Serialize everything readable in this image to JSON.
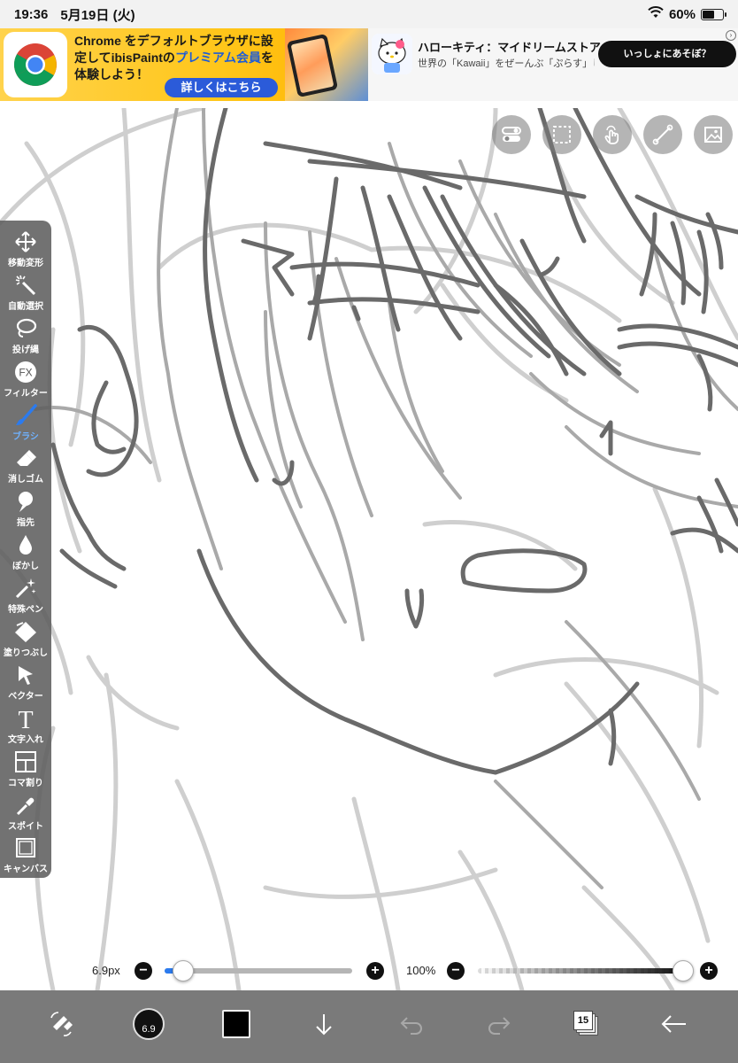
{
  "status_bar": {
    "time": "19:36",
    "date": "5月19日 (火)",
    "battery": "60%",
    "battery_level": 0.6
  },
  "ads": {
    "chrome": {
      "line1_prefix": "Chrome をデフォルトブラウザに設",
      "line2_prefix": "定してibisPaintの",
      "line2_highlight": "プレミアム会員",
      "line2_suffix": "を",
      "line3": "体験しよう！",
      "cta": "詳しくはこちら"
    },
    "kitty": {
      "title": "ハローキティ：マイドリームストア",
      "subtitle": "世界の「Kawaii」をぜーんぶ「ぷらす」し…",
      "cta": "いっしょにあそぼ？"
    }
  },
  "top_tools": [
    {
      "name": "toggle-icon"
    },
    {
      "name": "selection-icon"
    },
    {
      "name": "touch-icon"
    },
    {
      "name": "ruler-icon"
    },
    {
      "name": "reference-image-icon"
    }
  ],
  "toolbar": {
    "tools": [
      {
        "id": "move",
        "label": "移動変形",
        "icon": "move-icon",
        "active": false
      },
      {
        "id": "magic",
        "label": "自動選択",
        "icon": "magic-wand-icon",
        "active": false
      },
      {
        "id": "lasso",
        "label": "投げ縄",
        "icon": "lasso-icon",
        "active": false
      },
      {
        "id": "filter",
        "label": "フィルター",
        "icon": "fx-icon",
        "active": false
      },
      {
        "id": "brush",
        "label": "ブラシ",
        "icon": "brush-icon",
        "active": true
      },
      {
        "id": "eraser",
        "label": "消しゴム",
        "icon": "eraser-icon",
        "active": false
      },
      {
        "id": "smudge",
        "label": "指先",
        "icon": "finger-icon",
        "active": false
      },
      {
        "id": "blur",
        "label": "ぼかし",
        "icon": "drop-icon",
        "active": false
      },
      {
        "id": "special",
        "label": "特殊ペン",
        "icon": "sparkle-pen-icon",
        "active": false
      },
      {
        "id": "fill",
        "label": "塗りつぶし",
        "icon": "fill-icon",
        "active": false
      },
      {
        "id": "vector",
        "label": "ベクター",
        "icon": "vector-arrow-icon",
        "active": false
      },
      {
        "id": "text",
        "label": "文字入れ",
        "icon": "text-icon",
        "active": false
      },
      {
        "id": "frame",
        "label": "コマ割り",
        "icon": "frame-divider-icon",
        "active": false
      },
      {
        "id": "eyedropper",
        "label": "スポイト",
        "icon": "eyedropper-icon",
        "active": false
      },
      {
        "id": "canvas",
        "label": "キャンバス",
        "icon": "canvas-icon",
        "active": false
      }
    ]
  },
  "sliders": {
    "brush_size": {
      "value": "6.9px",
      "fraction": 0.1
    },
    "opacity": {
      "value": "100%",
      "fraction": 1.0
    }
  },
  "bottom_bar": {
    "brush_size_label": "6.9",
    "layer_count": "15",
    "current_color": "#000000"
  },
  "colors": {
    "accent": "#2b7bef",
    "toolbar_bg": "#5f5f5f",
    "bottom_bar_bg": "#7a7a7a"
  }
}
